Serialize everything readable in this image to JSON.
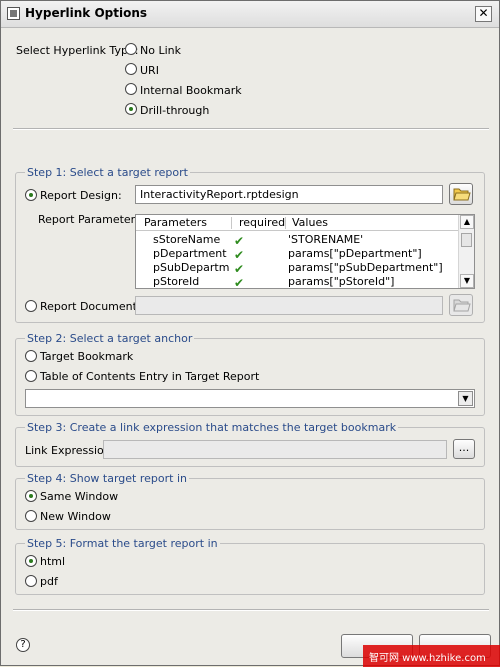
{
  "window": {
    "title": "Hyperlink Options",
    "close_glyph": "✕"
  },
  "link_type": {
    "label": "Select Hyperlink Type:",
    "options": [
      "No Link",
      "URI",
      "Internal Bookmark",
      "Drill-through"
    ],
    "selected": "Drill-through"
  },
  "step1": {
    "title": "Step 1: Select a target report",
    "report_design_label": "Report Design:",
    "report_design_value": "InteractivityReport.rptdesign",
    "report_parameters_label": "Report Parameters:",
    "table": {
      "columns": [
        "Parameters",
        "required",
        "Values"
      ],
      "rows": [
        {
          "name": "sStoreName",
          "required": true,
          "value": "'STORENAME'"
        },
        {
          "name": "pDepartment",
          "required": true,
          "value": "params[\"pDepartment\"]"
        },
        {
          "name": "pSubDepartm...",
          "required": true,
          "value": "params[\"pSubDepartment\"]"
        },
        {
          "name": "pStoreId",
          "required": true,
          "value": "params[\"pStoreId\"]"
        }
      ]
    },
    "report_document_label": "Report Document:",
    "report_document_value": ""
  },
  "step2": {
    "title": "Step 2: Select a target anchor",
    "options": [
      "Target Bookmark",
      "Table of Contents Entry in Target Report"
    ],
    "anchor_value": ""
  },
  "step3": {
    "title": "Step 3: Create a link expression that matches the target bookmark",
    "link_expression_label": "Link Expression:",
    "link_expression_value": "",
    "ellipsis_label": "..."
  },
  "step4": {
    "title": "Step 4: Show target report in",
    "options": [
      "Same Window",
      "New Window"
    ],
    "selected": "Same Window"
  },
  "step5": {
    "title": "Step 5: Format the target report in",
    "options": [
      "html",
      "pdf"
    ],
    "selected": "html"
  },
  "footer": {
    "help_glyph": "?",
    "watermark": "智可网 www.hzhike.com"
  },
  "colors": {
    "group_title": "#2a4b8a",
    "check": "#2e8b1e",
    "radio_dot": "#2c7a1e"
  }
}
